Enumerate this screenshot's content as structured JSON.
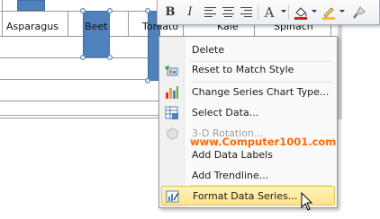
{
  "chart": {
    "categories": [
      "Asparagus",
      "Beet",
      "Tomato",
      "Kale",
      "Spinach"
    ],
    "bar_color": "#4f81bd",
    "selected_series": "Beet"
  },
  "mini_toolbar": {
    "bold_label": "B",
    "italic_label": "I",
    "font_color_label": "A",
    "buttons": [
      "bold-icon",
      "italic-icon",
      "align-left-icon",
      "align-center-icon",
      "align-right-icon",
      "font-color-icon",
      "fill-color-icon",
      "line-color-icon",
      "format-painter-icon"
    ]
  },
  "context_menu": {
    "items": [
      {
        "label": "Delete",
        "enabled": true,
        "icon": "none"
      },
      {
        "label": "Reset to Match Style",
        "enabled": true,
        "icon": "reset-style-icon"
      },
      {
        "label": "Change Series Chart Type...",
        "enabled": true,
        "icon": "chart-type-icon"
      },
      {
        "label": "Select Data...",
        "enabled": true,
        "icon": "select-data-icon"
      },
      {
        "label": "3-D Rotation...",
        "enabled": false,
        "icon": "3d-rotation-icon"
      },
      {
        "label": "Add Data Labels",
        "enabled": true,
        "icon": "none"
      },
      {
        "label": "Add Trendline...",
        "enabled": true,
        "icon": "none"
      },
      {
        "label": "Format Data Series...",
        "enabled": true,
        "icon": "format-series-icon",
        "highlighted": true
      }
    ],
    "highlight_color": "#ffe38a"
  },
  "watermark": "www.Computer1001.com",
  "watermark_color": "#ff6a00"
}
